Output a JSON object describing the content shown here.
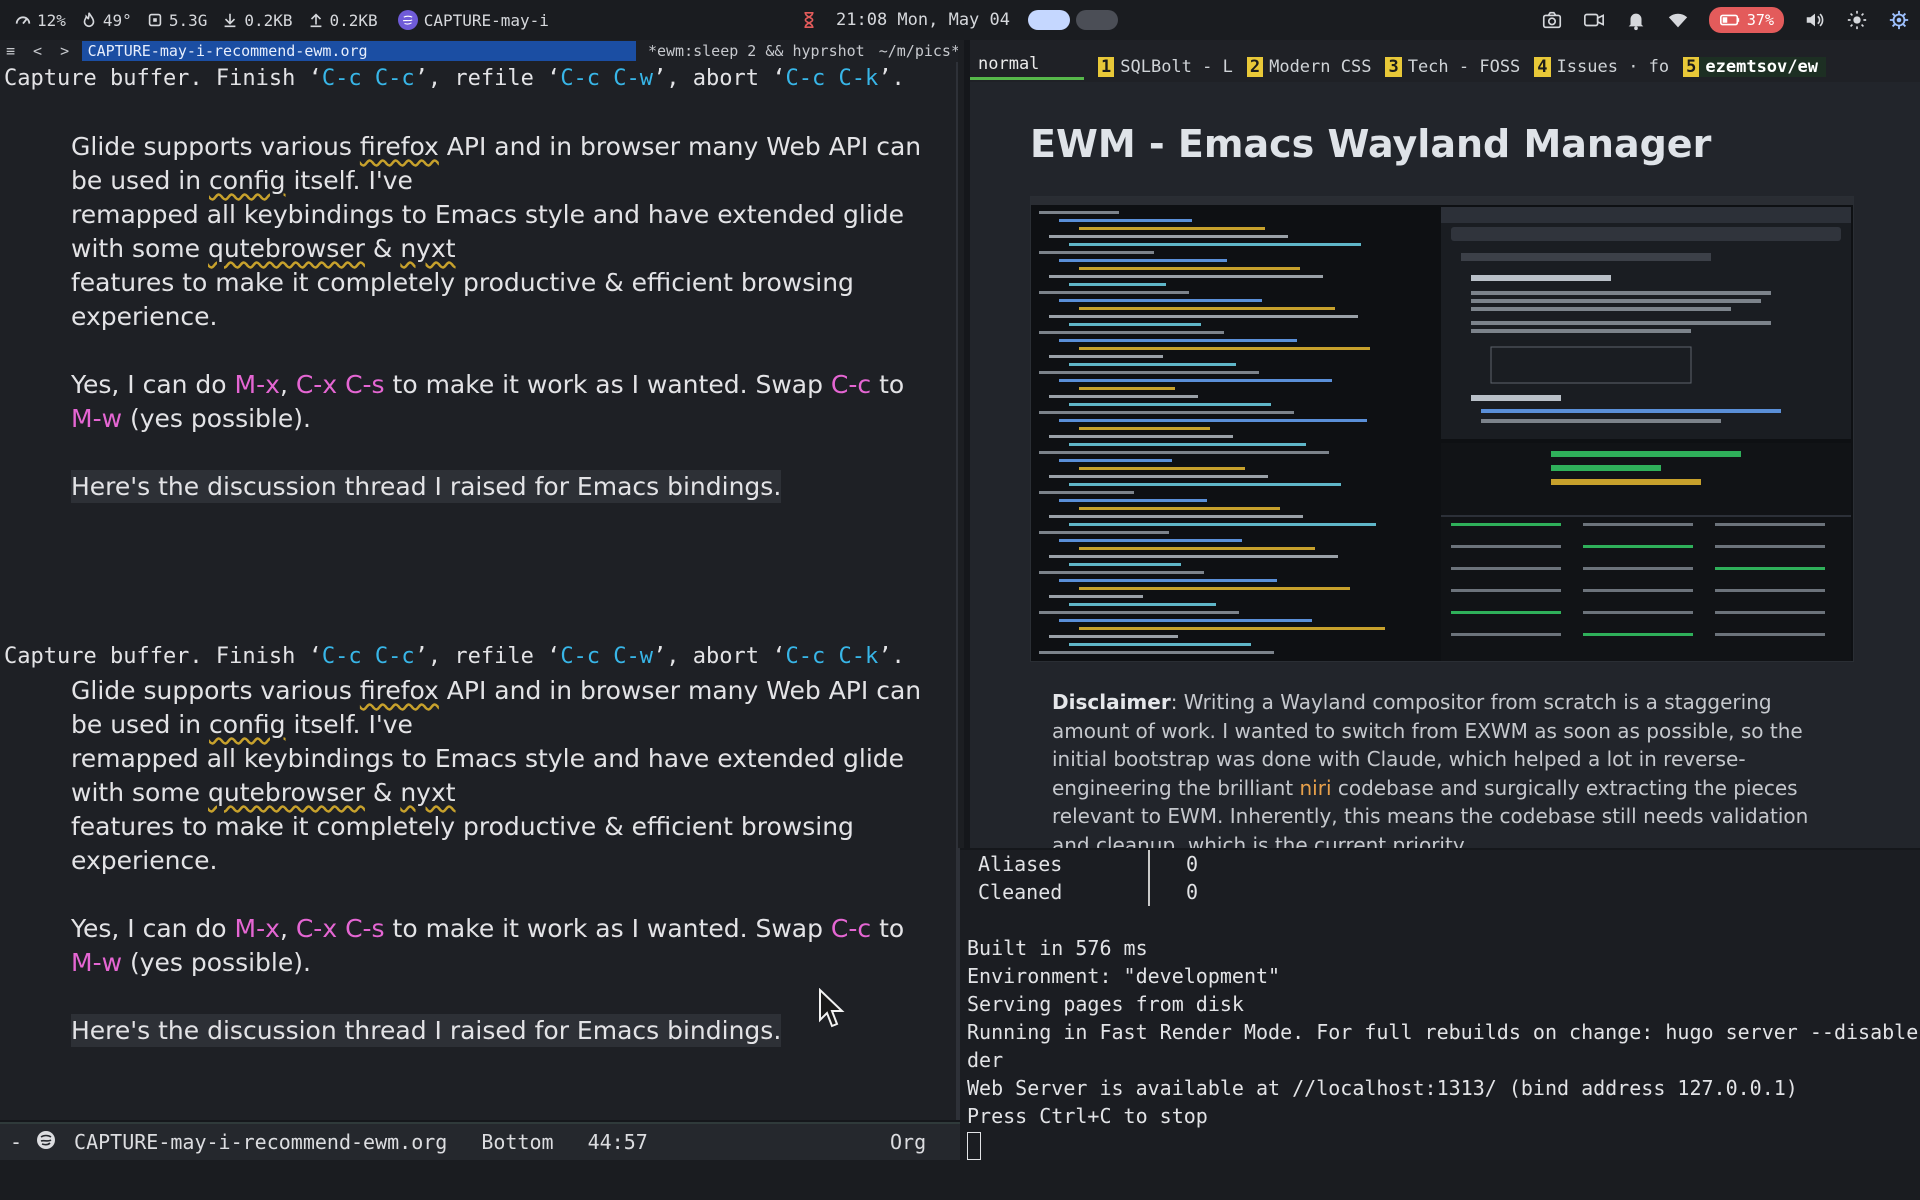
{
  "topbar": {
    "cpu": "12%",
    "temp": "49°",
    "mem": "5.3G",
    "down": "0.2KB",
    "up": "0.2KB",
    "active_app": "CAPTURE-may-i",
    "time": "21:08 Mon, May 04",
    "battery": "37%"
  },
  "emacs": {
    "tabline": {
      "nav_left": "<",
      "nav_right": ">",
      "active_tab": "CAPTURE-may-i-recommend-ewm.org",
      "other_tab": "*ewm:sleep 2 && hyprshot",
      "other_tab2": "~/m/pics*"
    },
    "block": {
      "cap_a": "Capture buffer.  Finish ‘",
      "key1": "C-c C-c",
      "cap_b": "’, refile ‘",
      "key2": "C-c C-w",
      "cap_c": "’, abort ‘",
      "key3": "C-c C-k",
      "cap_d": "’.",
      "p1_a": "Glide supports various ",
      "p1_firefox": "firefox",
      "p1_b": " API and in browser many Web API can be used in ",
      "p1_config": "config",
      "p1_c": " itself. I've",
      "p2_a": "remapped all keybindings to Emacs style and have extended glide with some ",
      "p2_qute": "qutebrowser",
      "p2_amp": " & ",
      "p2_nyxt": "nyxt",
      "p3": "features to make it completely productive & efficient browsing experience.",
      "p4_a": "Yes, I can do ",
      "p4_mx": "M-x",
      "p4_comma": ", ",
      "p4_cx": "C-x C-s",
      "p4_b": " to make it work as I wanted. Swap ",
      "p4_cc": "C-c",
      "p4_to": " to ",
      "p4_mw": "M-w",
      "p4_c": " (yes possible).",
      "p5": "Here's the discussion thread I raised for Emacs bindings."
    },
    "modeline": {
      "dash": "-",
      "buffer": "CAPTURE-may-i-recommend-ewm.org",
      "position": "Bottom",
      "linecol": "44:57",
      "mode": "Org"
    }
  },
  "browser": {
    "mode": "normal",
    "tabs": [
      {
        "num": "1",
        "title": "SQLBolt - L"
      },
      {
        "num": "2",
        "title": "Modern CSS"
      },
      {
        "num": "3",
        "title": "Tech - FOSS"
      },
      {
        "num": "4",
        "title": "Issues · fo"
      },
      {
        "num": "5",
        "title": "ezemtsov/ew"
      }
    ],
    "page_title": "EWM - Emacs Wayland Manager",
    "disclaimer_label": "Disclaimer",
    "disclaimer_a": ": Writing a Wayland compositor from scratch is a staggering amount of work. I wanted to switch from EXWM as soon as possible, so the initial bootstrap was done with Claude, which helped a lot in reverse-engineering the brilliant ",
    "disclaimer_link": "niri",
    "disclaimer_b": " codebase and surgically extracting the pieces relevant to EWM. Inherently, this means the codebase still needs validation and cleanup, which is the current priority."
  },
  "terminal": {
    "rows": [
      {
        "label": "Aliases",
        "value": "0"
      },
      {
        "label": "Cleaned",
        "value": "0"
      }
    ],
    "lines": [
      "Built in 576 ms",
      "Environment: \"development\"",
      "Serving pages from disk",
      "Running in Fast Render Mode. For full rebuilds on change: hugo server --disableFastRen",
      "der",
      "Web Server is available at //localhost:1313/ (bind address 127.0.0.1)",
      "Press Ctrl+C to stop"
    ]
  },
  "colors": {
    "key": "#38b6e8",
    "mkey": "#e566d3",
    "active_tab": "#1b4ea3",
    "mode_indicator": "#56b84a",
    "battery": "#e35b5b"
  }
}
